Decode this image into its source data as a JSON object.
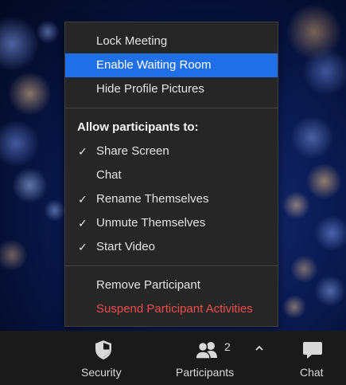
{
  "menu": {
    "items_top": [
      {
        "label": "Lock Meeting",
        "highlighted": false
      },
      {
        "label": "Enable Waiting Room",
        "highlighted": true
      },
      {
        "label": "Hide Profile Pictures",
        "highlighted": false
      }
    ],
    "section_header": "Allow participants to:",
    "permissions": [
      {
        "label": "Share Screen",
        "checked": true
      },
      {
        "label": "Chat",
        "checked": false
      },
      {
        "label": "Rename Themselves",
        "checked": true
      },
      {
        "label": "Unmute Themselves",
        "checked": true
      },
      {
        "label": "Start Video",
        "checked": true
      }
    ],
    "check_glyph": "✓",
    "items_bottom": [
      {
        "label": "Remove Participant",
        "danger": false
      },
      {
        "label": "Suspend Participant Activities",
        "danger": true
      }
    ],
    "highlight_color": "#1f70e8",
    "danger_color": "#f04e4e"
  },
  "toolbar": {
    "security": {
      "label": "Security",
      "icon": "shield-icon"
    },
    "participants": {
      "label": "Participants",
      "count": "2",
      "icon": "participants-icon",
      "caret": "^"
    },
    "chat": {
      "label": "Chat",
      "icon": "chat-bubble-icon"
    }
  }
}
